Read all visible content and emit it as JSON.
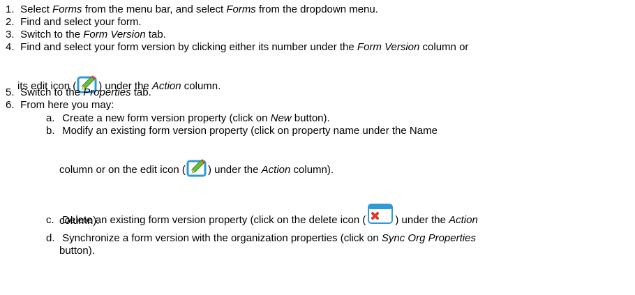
{
  "steps": [
    {
      "num": "1.",
      "p1": "Select ",
      "i1": "Forms",
      "p2": " from the menu bar, and select ",
      "i2": "Forms",
      "p3": " from the dropdown menu."
    },
    {
      "num": "2.",
      "p1": "Find and select your form."
    },
    {
      "num": "3.",
      "p1": "Switch to the ",
      "i1": "Form Version",
      "p2": " tab."
    },
    {
      "num": "4.",
      "p1": "Find and select your form version by clicking either its number under the ",
      "i1": "Form Version",
      "p2": " column or",
      "cont_p1": "its edit icon (",
      "cont_p2": ") under the ",
      "cont_i1": "Action",
      "cont_p3": " column."
    },
    {
      "num": "5.",
      "p1": "Switch to the ",
      "i1": "Properties",
      "p2": " tab."
    },
    {
      "num": "6.",
      "p1": "From here you may:"
    }
  ],
  "substeps": [
    {
      "letter": "a.",
      "p1": "Create a new form version property (click on ",
      "i1": "New",
      "p2": " button)."
    },
    {
      "letter": "b.",
      "p1": "Modify an existing form version property (click on property name under the Name",
      "cont_p1": "column or on the edit icon (",
      "cont_p2": ") under the ",
      "cont_i1": "Action",
      "cont_p3": " column)."
    },
    {
      "letter": "c.",
      "p1": "Delete an existing form version property (click on the delete icon (",
      "p2": ") under the ",
      "i1": "Action",
      "cont_p1": "column)."
    },
    {
      "letter": "d.",
      "p1": "Synchronize a form version with the organization properties (click on ",
      "i1": "Sync Org Properties",
      "cont_p1": "button)."
    }
  ],
  "icons": {
    "edit": "edit-icon",
    "delete": "delete-icon"
  }
}
